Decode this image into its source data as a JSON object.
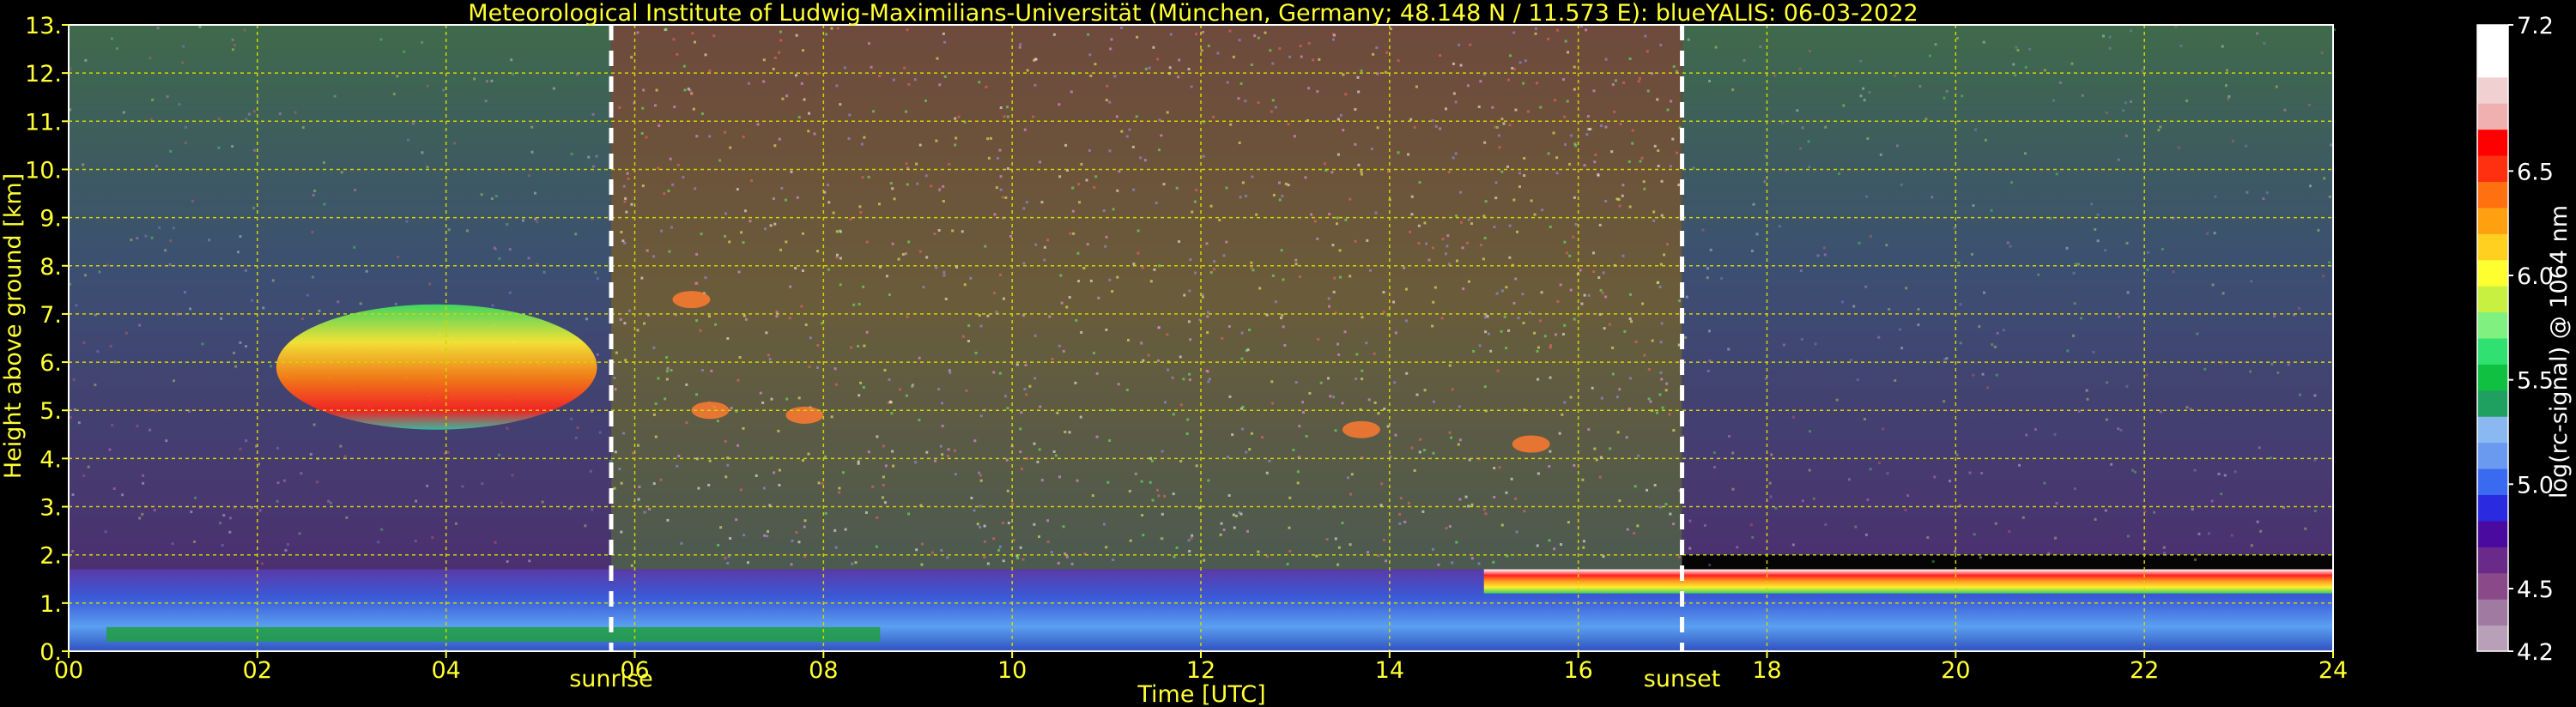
{
  "chart_data": {
    "type": "heatmap",
    "title": "Meteorological Institute of Ludwig-Maximilians-Universität (München, Germany; 48.148 N / 11.573 E):    blueYALIS: 06-03-2022",
    "xlabel": "Time [UTC]",
    "ylabel": "Height above ground [km]",
    "xlim": [
      0,
      24
    ],
    "ylim": [
      0,
      13
    ],
    "x_ticks": [
      "00",
      "02",
      "04",
      "06",
      "08",
      "10",
      "12",
      "14",
      "16",
      "18",
      "20",
      "22",
      "24"
    ],
    "y_ticks": [
      "0.",
      "1.",
      "2.",
      "3.",
      "4.",
      "5.",
      "6.",
      "7.",
      "8.",
      "9.",
      "10.",
      "11.",
      "12.",
      "13."
    ],
    "grid": true,
    "annotations": [
      {
        "label": "sunrise",
        "x": 5.75
      },
      {
        "label": "sunset",
        "x": 17.1
      }
    ],
    "colorbar": {
      "label": "log(rc-signal) @ 1064 nm",
      "range": [
        4.2,
        7.2
      ],
      "ticks": [
        "4.2",
        "4.5",
        "5.0",
        "5.5",
        "6.0",
        "6.5",
        "7.2"
      ]
    },
    "features": [
      {
        "name": "boundary layer",
        "x": [
          0,
          24
        ],
        "y": [
          0,
          1.7
        ]
      },
      {
        "name": "mid-level cloud",
        "x": [
          2.2,
          5.6
        ],
        "y": [
          4.6,
          7.2
        ]
      },
      {
        "name": "cloud top layer",
        "x": [
          15.0,
          24
        ],
        "y": [
          1.2,
          1.7
        ]
      },
      {
        "name": "high noise daytime",
        "x": [
          5.75,
          17.1
        ],
        "y": [
          2,
          13
        ]
      }
    ]
  }
}
